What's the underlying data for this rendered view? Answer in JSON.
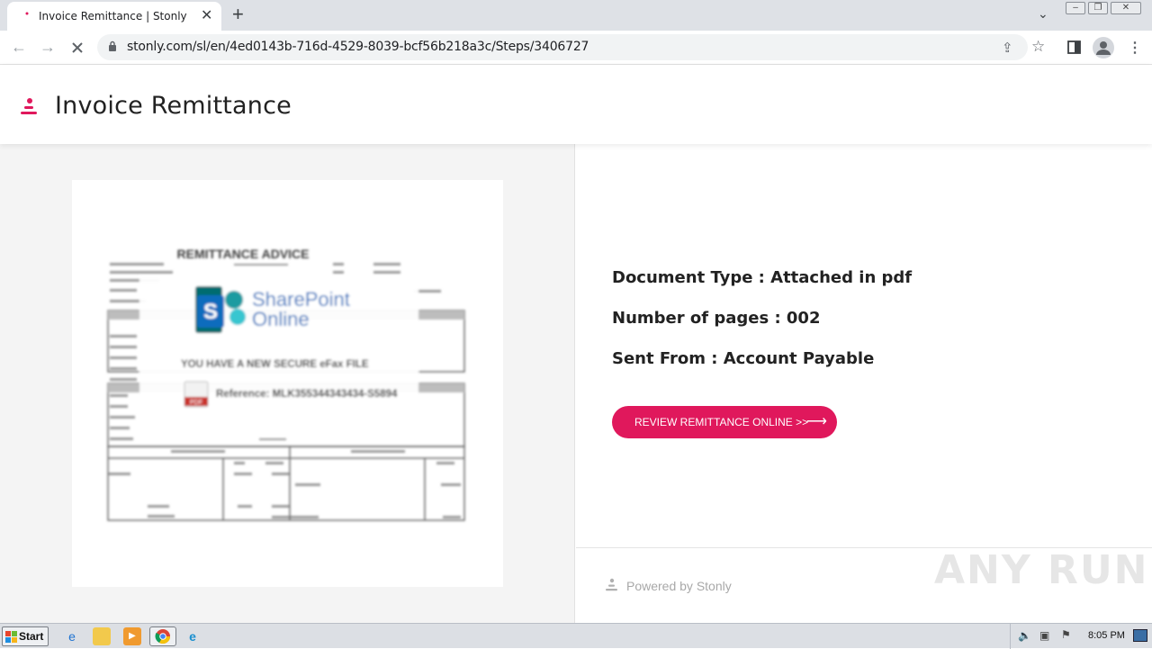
{
  "browser": {
    "tab_title": "Invoice Remittance | Stonly",
    "url": "stonly.com/sl/en/4ed0143b-716d-4529-8039-bcf56b218a3c/Steps/3406727"
  },
  "header": {
    "title": "Invoice Remittance"
  },
  "document_preview": {
    "heading": "REMITTANCE ADVICE",
    "product_line1": "SharePoint",
    "product_line2": "Online",
    "notice": "YOU HAVE A NEW SECURE eFax FILE",
    "reference": "Reference: MLK355344343434-S5894",
    "file_badge": "PDF"
  },
  "info": {
    "document_type": "Document Type : Attached in pdf",
    "pages": "Number of pages : 002",
    "sent_from": "Sent From : Account Payable"
  },
  "cta": {
    "label": "REVIEW REMITTANCE ONLINE >>",
    "arrow": "⟶"
  },
  "footer": {
    "powered_by": "Powered by Stonly",
    "watermark": "ANY RUN"
  },
  "taskbar": {
    "start_label": "Start",
    "clock": "8:05 PM"
  },
  "colors": {
    "accent": "#e0185c",
    "sharepoint_blue": "#0b6cbd"
  }
}
